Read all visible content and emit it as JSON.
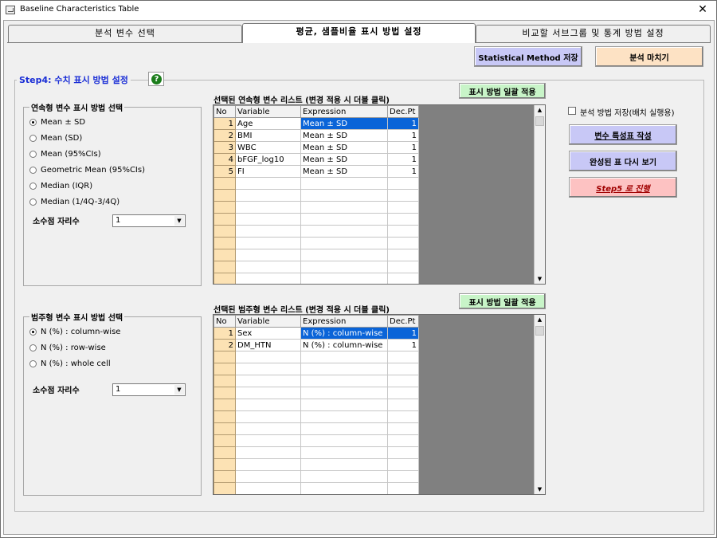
{
  "window": {
    "title": "Baseline Characteristics Table",
    "close_glyph": "✕"
  },
  "tabs": [
    {
      "label": "분석 변수 선택"
    },
    {
      "label": "평균, 샘플비율 표시 방법 설정"
    },
    {
      "label": "비교할 서브그룹 및 통계 방법 설정"
    }
  ],
  "toolbar": {
    "statistical_method_save": "Statistical Method 저장",
    "finish_analysis": "분석 마치기"
  },
  "step": {
    "title": "Step4: 수치 표시 방법 설정",
    "help_glyph": "?"
  },
  "continuous": {
    "group_title": "연속형 변수 표시 방법 선택",
    "options": [
      "Mean ± SD",
      "Mean (SD)",
      "Mean (95%CIs)",
      "Geometric Mean (95%CIs)",
      "Median (IQR)",
      "Median (1/4Q-3/4Q)"
    ],
    "selected_index": 0,
    "decimal_label": "소수점 자리수",
    "decimal_value": "1",
    "list_title": "선택된 연속형 변수 리스트 (변경 적용 시 더블 클릭)",
    "apply_all": "표시 방법 일괄 적용",
    "columns": [
      "No",
      "Variable",
      "Expression",
      "Dec.Pt"
    ],
    "rows": [
      {
        "no": "1",
        "variable": "Age",
        "expression": "Mean ± SD",
        "dec": "1"
      },
      {
        "no": "2",
        "variable": "BMI",
        "expression": "Mean ± SD",
        "dec": "1"
      },
      {
        "no": "3",
        "variable": "WBC",
        "expression": "Mean ± SD",
        "dec": "1"
      },
      {
        "no": "4",
        "variable": "bFGF_log10",
        "expression": "Mean ± SD",
        "dec": "1"
      },
      {
        "no": "5",
        "variable": "FI",
        "expression": "Mean ± SD",
        "dec": "1"
      }
    ]
  },
  "categorical": {
    "group_title": "범주형 변수 표시 방법 선택",
    "options": [
      "N (%) : column-wise",
      "N (%) : row-wise",
      "N (%) : whole cell"
    ],
    "selected_index": 0,
    "decimal_label": "소수점 자리수",
    "decimal_value": "1",
    "list_title": "선택된 범주형 변수 리스트 (변경 적용 시 더블 클릭)",
    "apply_all": "표시 방법 일괄 적용",
    "columns": [
      "No",
      "Variable",
      "Expression",
      "Dec.Pt"
    ],
    "rows": [
      {
        "no": "1",
        "variable": "Sex",
        "expression": "N (%) : column-wise",
        "dec": "1"
      },
      {
        "no": "2",
        "variable": "DM_HTN",
        "expression": "N (%) : column-wise",
        "dec": "1"
      }
    ]
  },
  "side": {
    "batch_save_label": "분석 방법 저장(배치 실행용)",
    "create_table": "변수 특성표 작성",
    "view_table": "완성된 표 다시 보기",
    "next_step": "Step5 로 진행"
  },
  "icons": {
    "scroll_up": "▲",
    "scroll_down": "▼",
    "combo_arrow": "▼"
  }
}
